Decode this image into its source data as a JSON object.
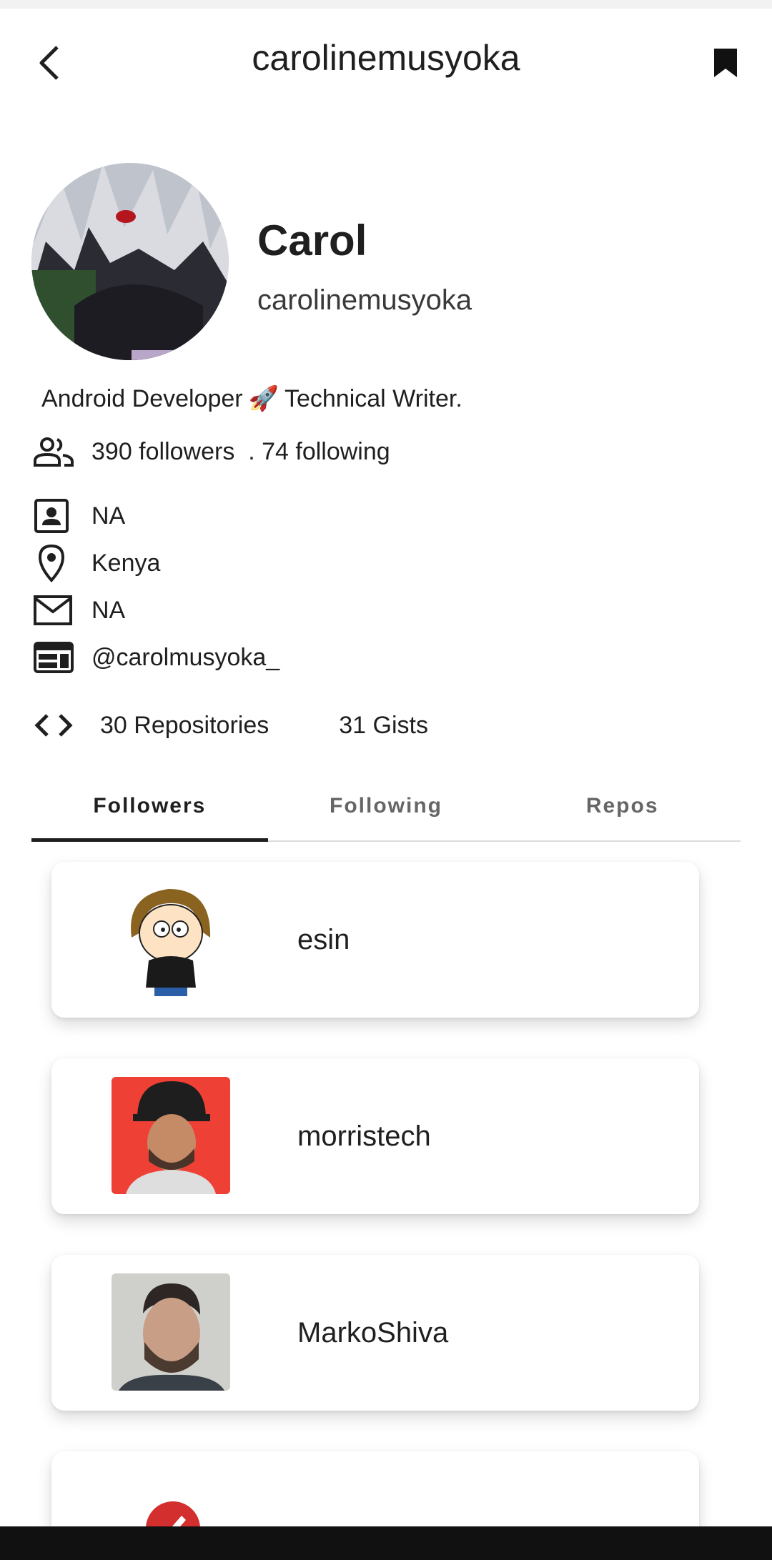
{
  "app_bar": {
    "title": "carolinemusyoka"
  },
  "profile": {
    "name": "Carol",
    "login": "carolinemusyoka",
    "bio": "Android Developer",
    "bio_emoji": "🚀",
    "bio_tail": "Technical Writer.",
    "followers_line": "390 followers  . 74 following",
    "company": "NA",
    "location": "Kenya",
    "email": "NA",
    "twitter": "@carolmusyoka_",
    "repositories": "30 Repositories",
    "gists": "31 Gists"
  },
  "tabs": [
    {
      "label": "Followers",
      "active": true
    },
    {
      "label": "Following",
      "active": false
    },
    {
      "label": "Repos",
      "active": false
    }
  ],
  "followers": [
    {
      "login": "esin"
    },
    {
      "login": "morristech"
    },
    {
      "login": "MarkoShiva"
    },
    {
      "login": "."
    }
  ],
  "colors": {
    "text": "#1f1f1f",
    "inactive_tab": "#666666",
    "tab_indicator": "#1f1f1f"
  }
}
